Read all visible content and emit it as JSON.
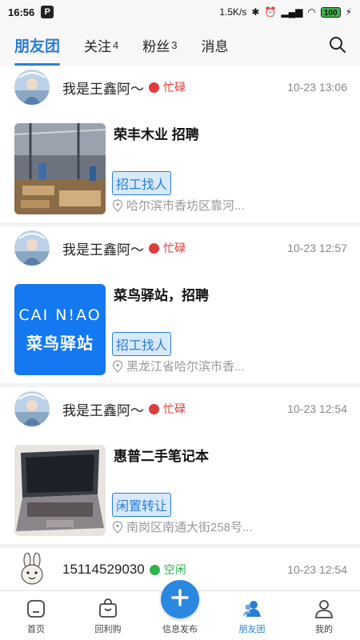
{
  "status_bar": {
    "time": "16:56",
    "app_badge": "P",
    "network_speed": "1.5K/s",
    "battery": "100"
  },
  "top_tabs": [
    {
      "label": "朋友团",
      "count": ""
    },
    {
      "label": "关注",
      "count": "4"
    },
    {
      "label": "粉丝",
      "count": "3"
    },
    {
      "label": "消息",
      "count": ""
    }
  ],
  "feed": {
    "posts": [
      {
        "user": "我是王鑫阿～",
        "status": "忙碌",
        "time": "10-23 13:06",
        "title": "荣丰木业 招聘",
        "tag": "招工找人",
        "location": "哈尔滨市香坊区靠河..."
      },
      {
        "user": "我是王鑫阿～",
        "status": "忙碌",
        "time": "10-23 12:57",
        "title": "菜鸟驿站，招聘",
        "tag": "招工找人",
        "location": "黑龙江省哈尔滨市香...",
        "thumb_logo_top": "CAI N!AO",
        "thumb_logo_bottom": "菜鸟驿站"
      },
      {
        "user": "我是王鑫阿～",
        "status": "忙碌",
        "time": "10-23 12:54",
        "title": "惠普二手笔记本",
        "tag": "闲置转让",
        "location": "南岗区南通大街258号..."
      },
      {
        "user": "15114529030",
        "status": "空闲",
        "time": "10-23 12:54"
      }
    ]
  },
  "bottom_nav": [
    {
      "label": "首页"
    },
    {
      "label": "回利购"
    },
    {
      "label": "信息发布"
    },
    {
      "label": "朋友团"
    },
    {
      "label": "我的"
    }
  ],
  "colors": {
    "accent": "#2a7fd4",
    "busy": "#e03a3a",
    "free": "#2fb34a"
  }
}
